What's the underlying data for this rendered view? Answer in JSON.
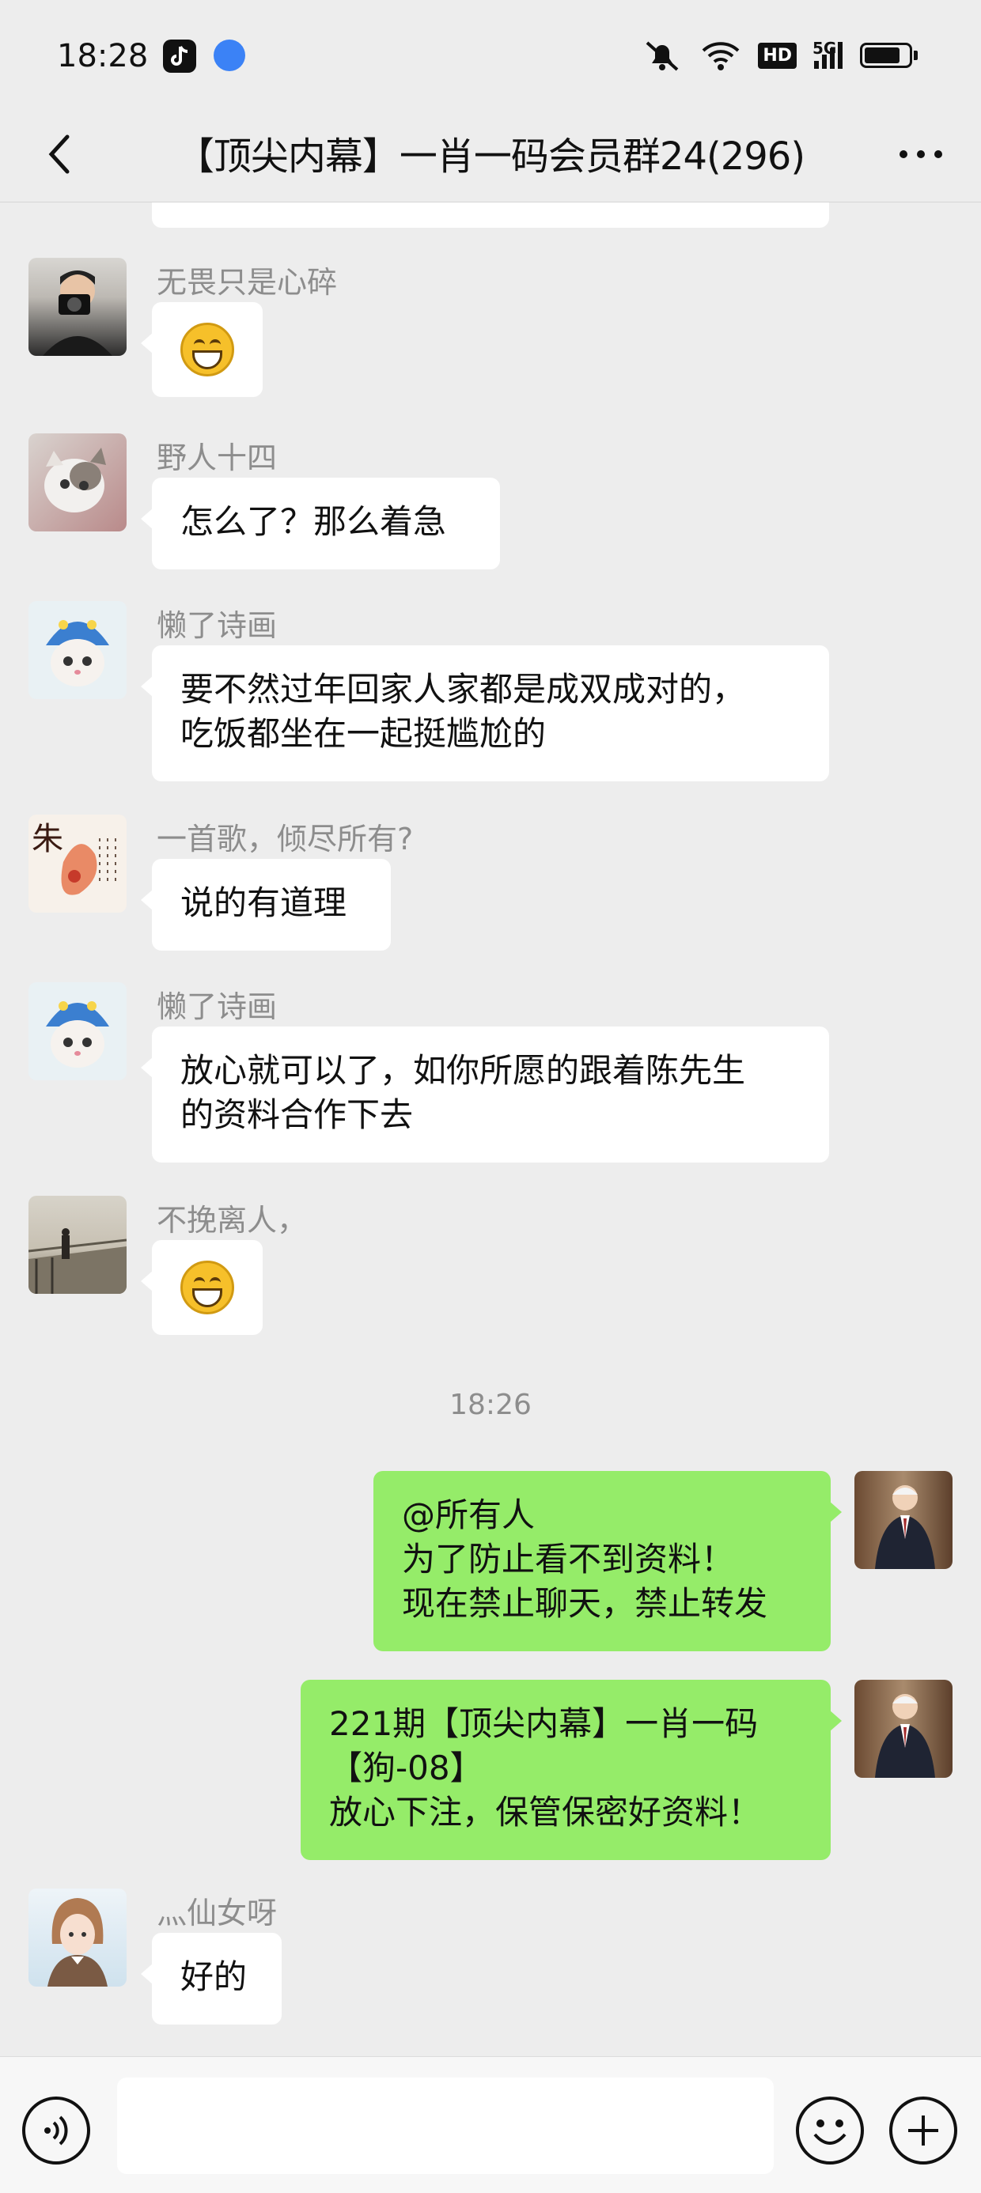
{
  "status_bar": {
    "time": "18:28",
    "network_label": "5G",
    "hd_label": "HD"
  },
  "header": {
    "title": "【顶尖内幕】一肖一码会员群24(296)"
  },
  "messages": [
    {
      "sender": "无畏只是心碎",
      "type": "emoji"
    },
    {
      "sender": "野人十四",
      "lines": [
        "怎么了？那么着急"
      ]
    },
    {
      "sender": "懒了诗画",
      "lines": [
        "要不然过年回家人家都是成双成对的，",
        "吃饭都坐在一起挺尴尬的"
      ]
    },
    {
      "sender": "一首歌，倾尽所有?",
      "lines": [
        "说的有道理"
      ]
    },
    {
      "sender": "懒了诗画",
      "lines": [
        "放心就可以了，如你所愿的跟着陈先生",
        "的资料合作下去"
      ]
    },
    {
      "sender": "不挽离人，",
      "type": "emoji"
    },
    {
      "sender": "灬仙女呀",
      "lines": [
        "好的"
      ]
    }
  ],
  "timestamp": "18:26",
  "my_messages": [
    {
      "lines": [
        "@所有人",
        "为了防止看不到资料！",
        "现在禁止聊天，禁止转发"
      ]
    },
    {
      "lines": [
        "221期【顶尖内幕】一肖一码",
        "【狗-08】",
        "放心下注，保管保密好资料！"
      ]
    }
  ],
  "colors": {
    "background": "#ededed",
    "my_bubble": "#95ec69",
    "their_bubble": "#ffffff"
  },
  "icons": [
    "back-icon",
    "more-icon",
    "voice-icon",
    "emoji-icon",
    "plus-icon"
  ]
}
